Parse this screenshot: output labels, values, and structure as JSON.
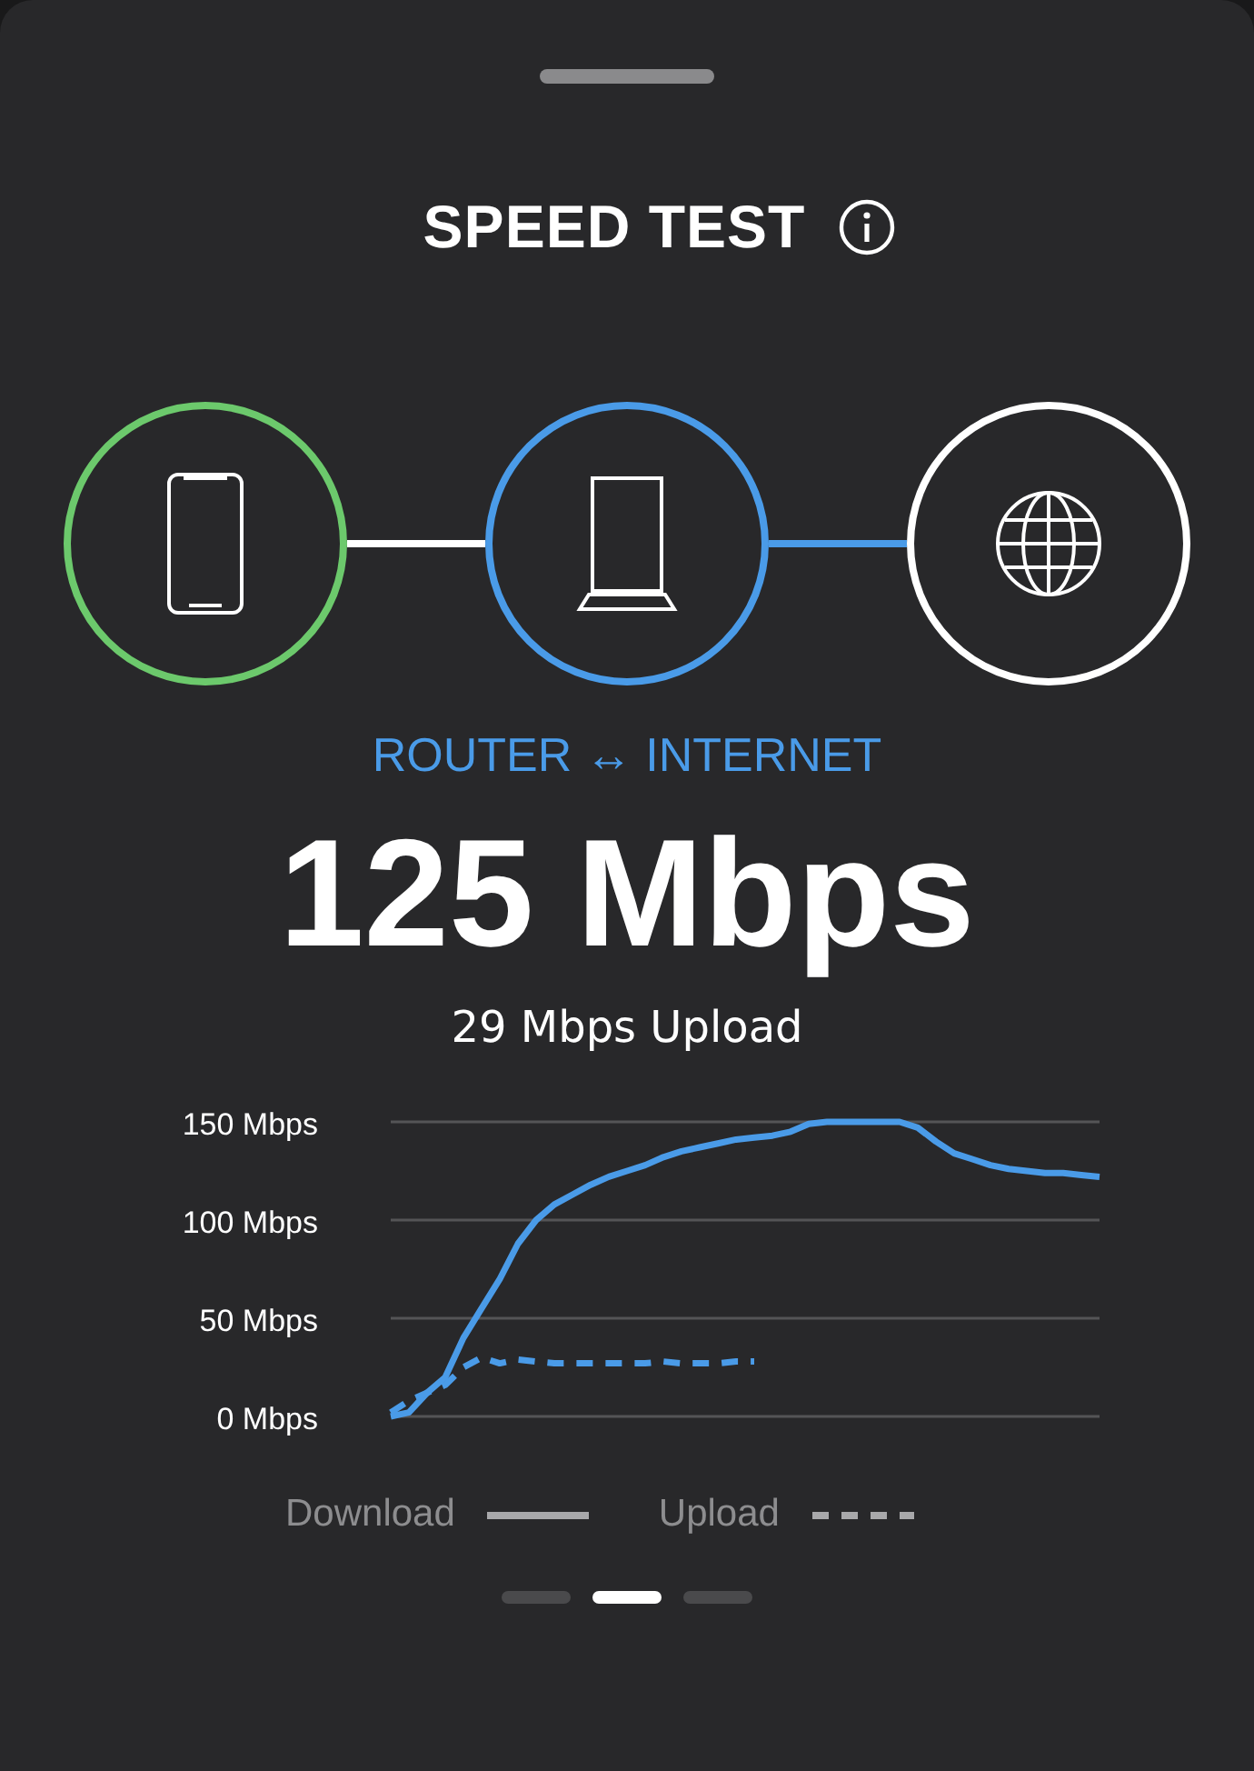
{
  "title": "SPEED TEST",
  "nodes": [
    {
      "kind": "phone",
      "color": "#6cc96c"
    },
    {
      "kind": "router",
      "color": "#4a9be8"
    },
    {
      "kind": "globe",
      "color": "#ffffff"
    }
  ],
  "links": [
    {
      "color": "#ffffff"
    },
    {
      "color": "#4a9be8"
    }
  ],
  "segment_label": "ROUTER ↔ INTERNET",
  "speed": "125 Mbps",
  "upload": "29 Mbps Upload",
  "chart_data": {
    "type": "line",
    "grid": true,
    "ylim": [
      0,
      150
    ],
    "yticks": [
      {
        "value": 0,
        "label": "0 Mbps"
      },
      {
        "value": 50,
        "label": "50 Mbps"
      },
      {
        "value": 100,
        "label": "100 Mbps"
      },
      {
        "value": 150,
        "label": "150 Mbps"
      }
    ],
    "series": [
      {
        "name": "Download",
        "color": "#4a9be8",
        "line_style": "solid",
        "values": [
          0,
          2,
          12,
          20,
          40,
          55,
          70,
          88,
          100,
          108,
          113,
          118,
          122,
          125,
          128,
          132,
          135,
          137,
          139,
          141,
          142,
          143,
          145,
          149,
          150,
          150,
          150,
          150,
          150,
          147,
          140,
          134,
          131,
          128,
          126,
          125,
          124,
          124,
          123,
          122
        ]
      },
      {
        "name": "Upload",
        "color": "#4a9be8",
        "line_style": "dashed",
        "values": [
          2,
          8,
          12,
          16,
          25,
          30,
          27,
          29,
          28,
          27,
          27,
          27,
          27,
          27,
          27,
          28,
          27,
          27,
          27,
          28,
          28,
          null,
          null,
          null,
          null,
          null,
          null,
          null,
          null,
          null,
          null,
          null,
          null,
          null,
          null,
          null,
          null,
          null,
          null,
          null
        ]
      }
    ]
  },
  "pages": [
    {
      "selected": false
    },
    {
      "selected": true
    },
    {
      "selected": false
    }
  ]
}
